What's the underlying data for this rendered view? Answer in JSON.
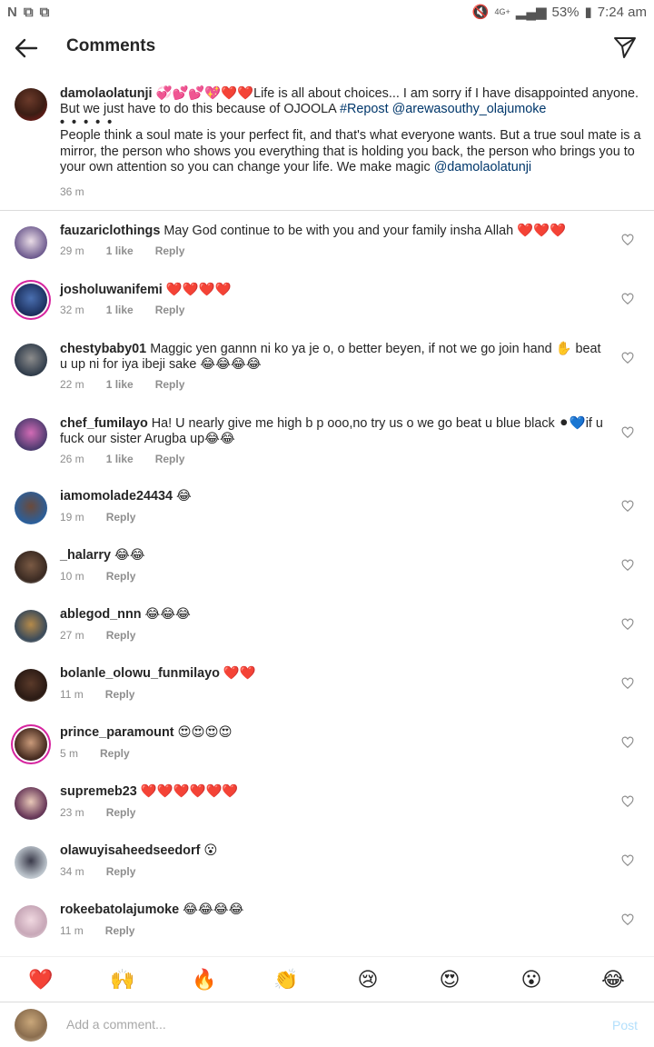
{
  "status": {
    "left": "N 🖼 🖼",
    "battery": "53%",
    "time": "7:24 am",
    "net": "4G+"
  },
  "header": {
    "title": "Comments"
  },
  "caption": {
    "user": "damolaolatunji",
    "emojis": "💞💕💕💖❤️❤️",
    "text1": "Life is all about choices... I am sorry if I have disappointed anyone. But we just have to do this because of OJOOLA ",
    "tag": "#Repost",
    "mention": "@arewasouthy_olajumoke",
    "dots": "• • • • •",
    "text2": "People think a soul mate is your perfect fit, and that's what everyone wants. But a true soul mate is a mirror, the person who shows you everything that is holding you back, the person who brings you to your own attention so you can change your life. We make magic ",
    "mention2": "@damolaolatunji",
    "time": "36 m"
  },
  "comments": [
    {
      "user": "fauzariclothings",
      "text": "May God continue to be with you and your family insha Allah ❤️❤️❤️",
      "time": "29 m",
      "likes": "1 like",
      "reply": "Reply"
    },
    {
      "user": "josholuwanifemi",
      "text": "❤️❤️❤️❤️",
      "time": "32 m",
      "likes": "1 like",
      "reply": "Reply"
    },
    {
      "user": "chestybaby01",
      "text": "Maggic yen gannn ni ko ya je o, o better beyen, if not we go join hand ✋ beat u up ni for iya ibeji sake 😂😂😂😂",
      "time": "22 m",
      "likes": "1 like",
      "reply": "Reply"
    },
    {
      "user": "chef_fumilayo",
      "text": "Ha! U nearly give me high b p ooo,no try us o we go beat u blue black ⚫💙if u fuck our sister Arugba up😂😂",
      "time": "26 m",
      "likes": "1 like",
      "reply": "Reply"
    },
    {
      "user": "iamomolade24434",
      "text": "😂",
      "time": "19 m",
      "likes": "",
      "reply": "Reply"
    },
    {
      "user": "_halarry",
      "text": "😂😂",
      "time": "10 m",
      "likes": "",
      "reply": "Reply"
    },
    {
      "user": "ablegod_nnn",
      "text": "😂😂😂",
      "time": "27 m",
      "likes": "",
      "reply": "Reply"
    },
    {
      "user": "bolanle_olowu_funmilayo",
      "text": "❤️❤️",
      "time": "11 m",
      "likes": "",
      "reply": "Reply"
    },
    {
      "user": "prince_paramount",
      "text": "😍😍😍😍",
      "time": "5 m",
      "likes": "",
      "reply": "Reply"
    },
    {
      "user": "supremeb23",
      "text": "❤️❤️❤️❤️❤️❤️",
      "time": "23 m",
      "likes": "",
      "reply": "Reply"
    },
    {
      "user": "olawuyisaheedseedorf",
      "text": "😮",
      "time": "34 m",
      "likes": "",
      "reply": "Reply"
    },
    {
      "user": "rokeebatolajumoke",
      "text": "😂😂😂😂",
      "time": "11 m",
      "likes": "",
      "reply": "Reply"
    }
  ],
  "emoji_bar": [
    "❤️",
    "🙌",
    "🔥",
    "👏",
    "😢",
    "😍",
    "😮",
    "😂"
  ],
  "composer": {
    "placeholder": "Add a comment...",
    "post": "Post"
  }
}
